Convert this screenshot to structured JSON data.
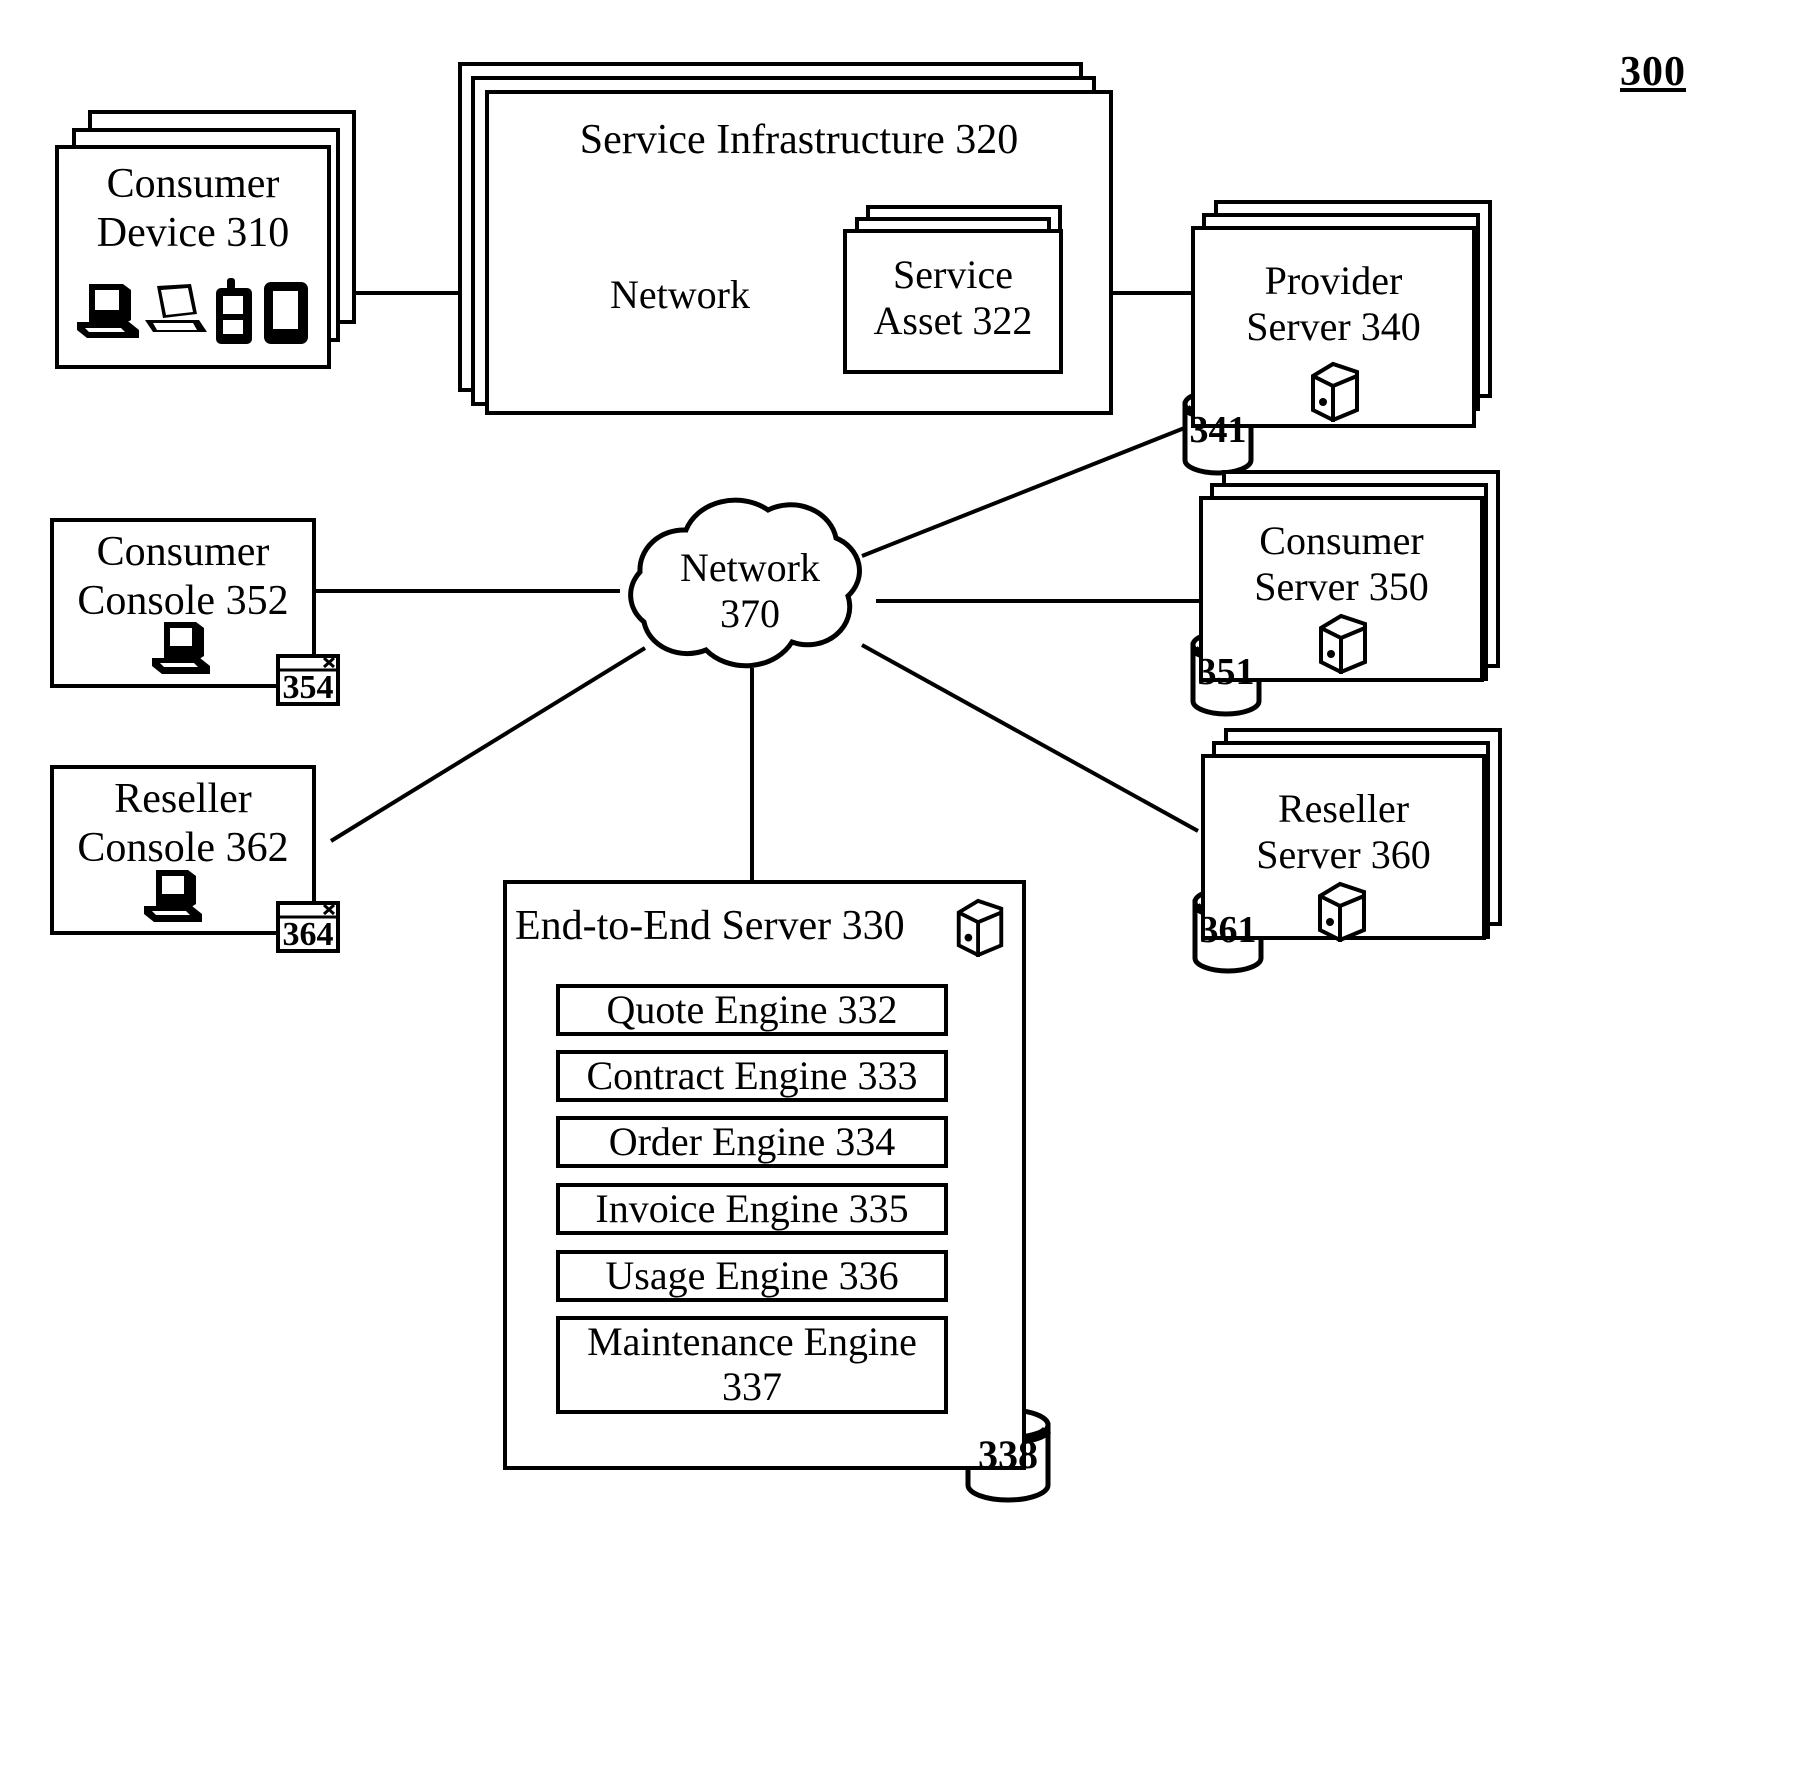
{
  "figure": {
    "number": "300"
  },
  "nodes": {
    "consumer_device": {
      "label": "Consumer\nDevice 310",
      "icons": [
        "desktop-computer-icon",
        "laptop-icon",
        "cell-phone-icon",
        "pda-icon"
      ]
    },
    "service_infrastructure": {
      "label": "Service Infrastructure 320"
    },
    "service_network": {
      "label": "Network"
    },
    "service_asset": {
      "label": "Service\nAsset 322"
    },
    "provider_server": {
      "label": "Provider\nServer 340",
      "icon": "server-tower-icon",
      "database": "341"
    },
    "consumer_server": {
      "label": "Consumer\nServer 350",
      "icon": "server-tower-icon",
      "database": "351"
    },
    "reseller_server": {
      "label": "Reseller\nServer 360",
      "icon": "server-tower-icon",
      "database": "361"
    },
    "consumer_console": {
      "label": "Consumer\nConsole 352",
      "icon": "desktop-computer-icon",
      "window_badge": "354"
    },
    "reseller_console": {
      "label": "Reseller\nConsole 362",
      "icon": "desktop-computer-icon",
      "window_badge": "364"
    },
    "network_370": {
      "label": "Network\n370"
    },
    "end_to_end_server": {
      "label": "End-to-End Server 330",
      "icon": "server-tower-icon",
      "database": "338",
      "engines": [
        {
          "label": "Quote Engine 332"
        },
        {
          "label": "Contract Engine 333"
        },
        {
          "label": "Order Engine 334"
        },
        {
          "label": "Invoice Engine 335"
        },
        {
          "label": "Usage Engine 336"
        },
        {
          "label": "Maintenance Engine\n337"
        }
      ]
    }
  },
  "colors": {
    "line": "#000000",
    "background": "#ffffff"
  }
}
